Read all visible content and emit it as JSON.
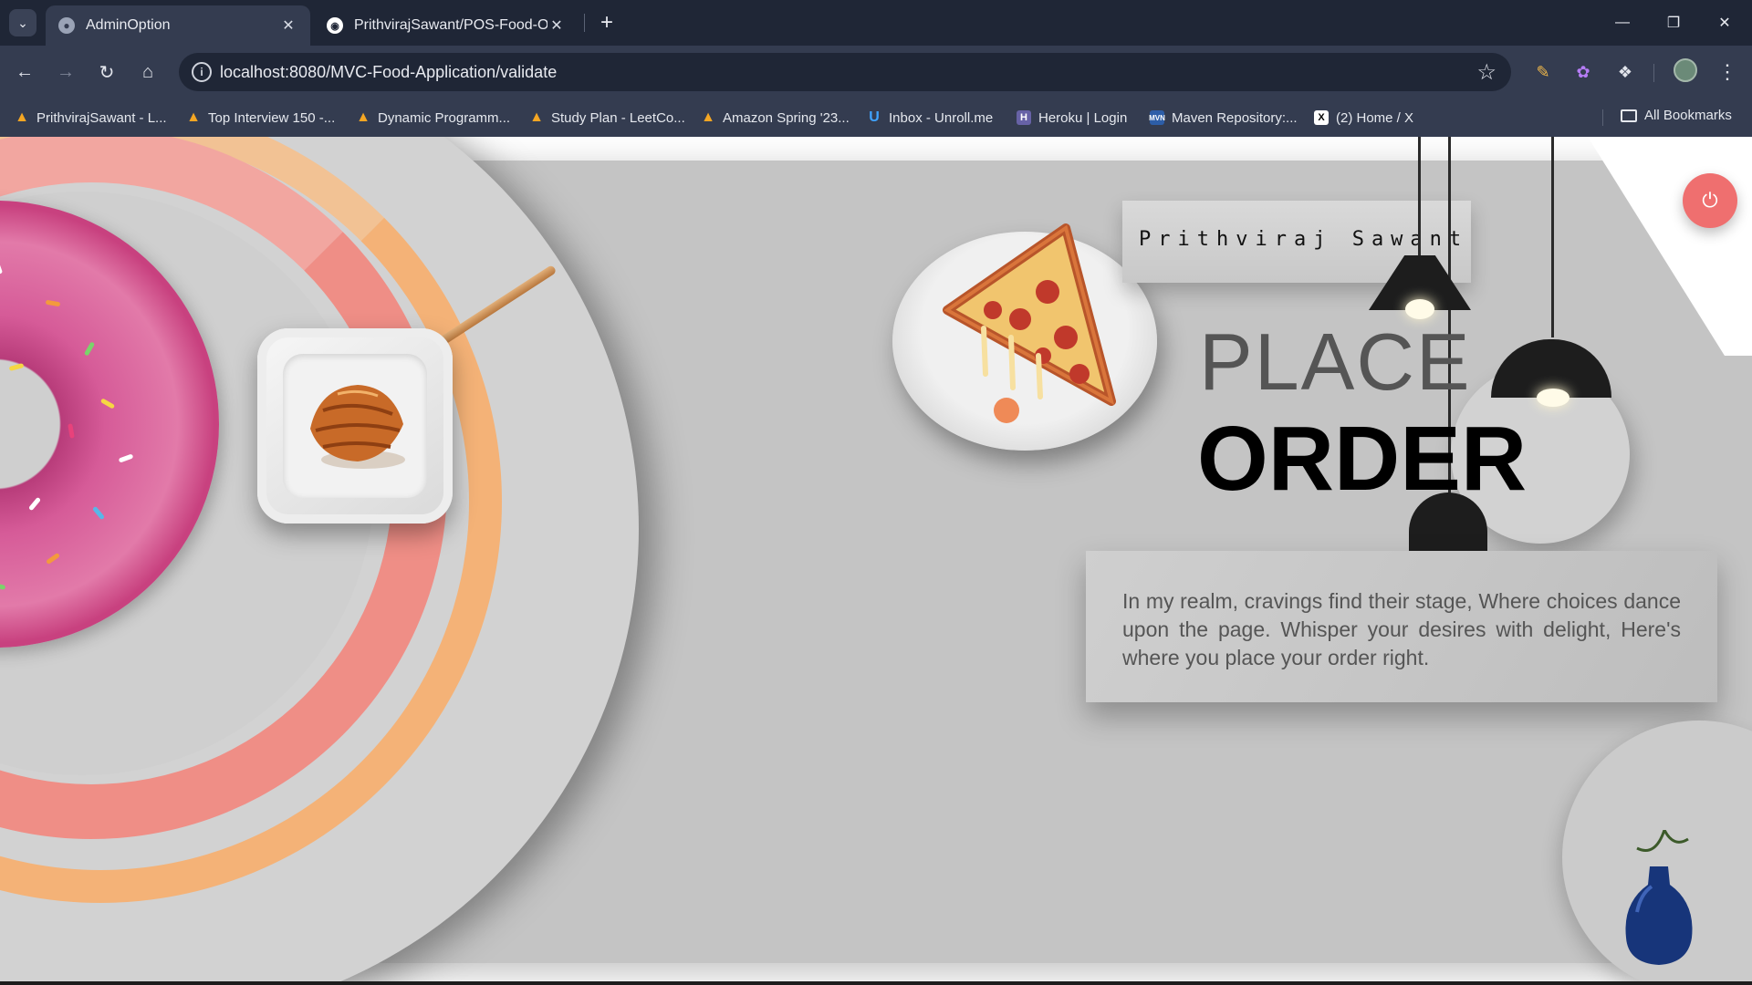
{
  "browser": {
    "tabs": [
      {
        "title": "AdminOption",
        "active": true,
        "icon": "globe-icon"
      },
      {
        "title": "PrithvirajSawant/POS-Food-Ord",
        "active": false,
        "icon": "github-icon"
      }
    ],
    "address_bar": {
      "url": "localhost:8080/MVC-Food-Application/validate"
    },
    "bookmarks": [
      {
        "label": "PrithvirajSawant - L...",
        "icon": "leetcode-icon"
      },
      {
        "label": "Top Interview 150 -...",
        "icon": "leetcode-icon"
      },
      {
        "label": "Dynamic Programm...",
        "icon": "leetcode-icon"
      },
      {
        "label": "Study Plan - LeetCo...",
        "icon": "leetcode-icon"
      },
      {
        "label": "Amazon Spring '23...",
        "icon": "leetcode-icon"
      },
      {
        "label": "Inbox - Unroll.me",
        "icon": "unroll-icon"
      },
      {
        "label": "Heroku | Login",
        "icon": "heroku-icon"
      },
      {
        "label": "Maven Repository:...",
        "icon": "maven-icon"
      },
      {
        "label": "(2) Home / X",
        "icon": "x-icon"
      }
    ],
    "all_bookmarks_label": "All Bookmarks"
  },
  "page": {
    "user_name": "Prithviraj Sawant",
    "heading_light": "PLACE",
    "heading_bold": "ORDER",
    "description": "In my realm, cravings find their stage, Where choices dance upon the page. Whisper your desires with delight, Here's where you place your order right.",
    "colors": {
      "panel": "#c4c4c4",
      "power_button": "#ef6f6f",
      "ring_orange": "#f4b277",
      "ring_pink": "#ef8e86"
    }
  }
}
